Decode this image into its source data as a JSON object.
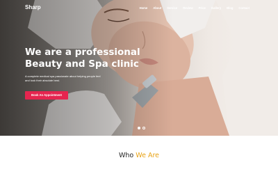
{
  "brand": {
    "logo_text": "Sharp"
  },
  "nav": {
    "items": [
      {
        "label": "Home"
      },
      {
        "label": "About"
      },
      {
        "label": "Service"
      },
      {
        "label": "Review"
      },
      {
        "label": "Price"
      },
      {
        "label": "Gallery"
      },
      {
        "label": "Blog"
      },
      {
        "label": "Contact"
      }
    ]
  },
  "hero": {
    "title_line1": "We are a professional",
    "title_line2": "Beauty and Spa clinic",
    "subtitle": "A complete medical spa passionate about helping people feel and look their absolute best.",
    "cta_label": "Book An Appointment",
    "slide_count": 2,
    "active_slide": 1
  },
  "section": {
    "heading_part1": "Who",
    "heading_part2": "We Are"
  },
  "colors": {
    "accent_button": "#e5254f",
    "heading_accent": "#e8a317"
  }
}
